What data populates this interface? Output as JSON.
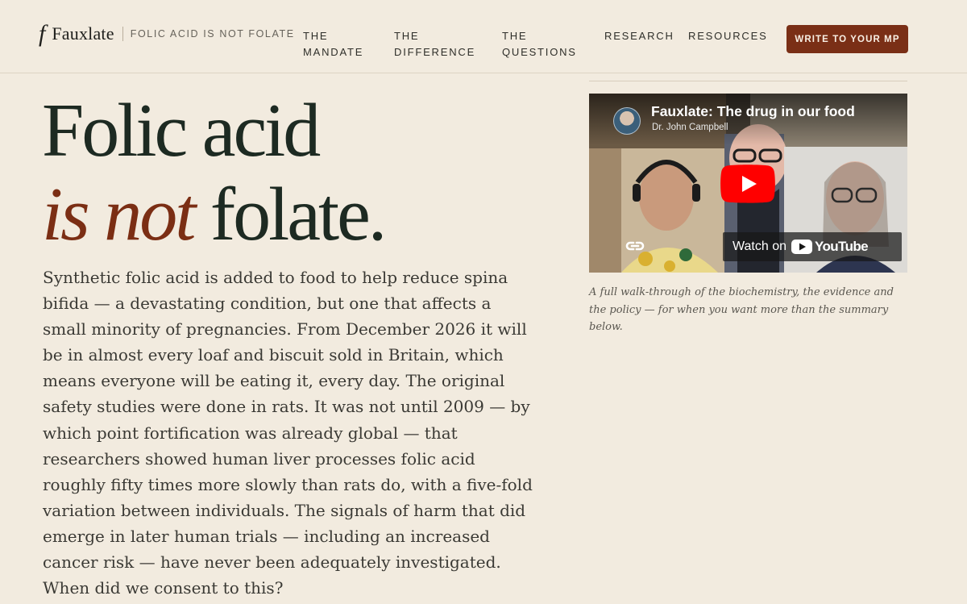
{
  "brand": {
    "mark": "f",
    "name": "Fauxlate",
    "tagline": "FOLIC ACID IS NOT FOLATE"
  },
  "nav": {
    "items": [
      {
        "line1": "THE",
        "line2": "MANDATE"
      },
      {
        "line1": "THE",
        "line2": "DIFFERENCE"
      },
      {
        "line1": "THE",
        "line2": "QUESTIONS"
      },
      {
        "line1": "RESEARCH",
        "line2": ""
      },
      {
        "line1": "RESOURCES",
        "line2": ""
      }
    ],
    "cta_label": "WRITE TO YOUR MP"
  },
  "hero": {
    "headline_line1": "Folic acid",
    "headline_accent": "is not",
    "headline_rest": " folate.",
    "body": "Synthetic folic acid is added to food to help reduce spina bifida — a devastating condition, but one that affects a small minority of pregnancies. From December 2026 it will be in almost every loaf and biscuit sold in Britain, which means everyone will be eating it, every day. The original safety studies were done in rats. It was not until 2009 — by which point fortification was already global — that researchers showed human liver processes folic acid roughly fifty times more slowly than rats do, with a five-fold variation between individuals. The signals of harm that did emerge in later human trials — including an increased cancer risk — have never been adequately investigated. When did we consent to this?"
  },
  "video": {
    "title": "Fauxlate: The drug in our food",
    "channel": "Dr. John Campbell",
    "watch_label": "Watch on",
    "platform": "YouTube",
    "caption": "A full walk-through of the biochemistry, the evidence and the policy — for when you want more than the summary below."
  },
  "colors": {
    "background": "#f2ebdf",
    "accent": "#7b2e14",
    "cta": "#7a2f16",
    "headline": "#1d2a22",
    "youtube_red": "#ff0000"
  },
  "icons": [
    "play-icon",
    "youtube-logo-icon",
    "link-icon"
  ]
}
